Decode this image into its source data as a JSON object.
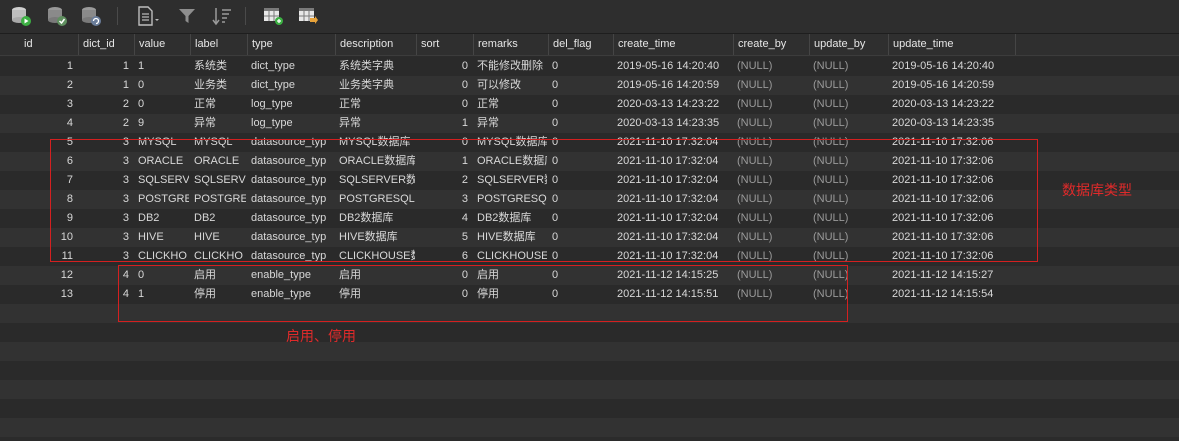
{
  "columns": [
    "id",
    "dict_id",
    "value",
    "label",
    "type",
    "description",
    "sort",
    "remarks",
    "del_flag",
    "create_time",
    "create_by",
    "update_by",
    "update_time"
  ],
  "rows": [
    [
      "1",
      "1",
      "1",
      "系统类",
      "dict_type",
      "系统类字典",
      "0",
      "不能修改删除",
      "0",
      "2019-05-16 14:20:40",
      "(NULL)",
      "(NULL)",
      "2019-05-16 14:20:40"
    ],
    [
      "2",
      "1",
      "0",
      "业务类",
      "dict_type",
      "业务类字典",
      "0",
      "可以修改",
      "0",
      "2019-05-16 14:20:59",
      "(NULL)",
      "(NULL)",
      "2019-05-16 14:20:59"
    ],
    [
      "3",
      "2",
      "0",
      "正常",
      "log_type",
      "正常",
      "0",
      "正常",
      "0",
      "2020-03-13 14:23:22",
      "(NULL)",
      "(NULL)",
      "2020-03-13 14:23:22"
    ],
    [
      "4",
      "2",
      "9",
      "异常",
      "log_type",
      "异常",
      "1",
      "异常",
      "0",
      "2020-03-13 14:23:35",
      "(NULL)",
      "(NULL)",
      "2020-03-13 14:23:35"
    ],
    [
      "5",
      "3",
      "MYSQL",
      "MYSQL",
      "datasource_typ",
      "MYSQL数据库",
      "0",
      "MYSQL数据库",
      "0",
      "2021-11-10 17:32:04",
      "(NULL)",
      "(NULL)",
      "2021-11-10 17:32:06"
    ],
    [
      "6",
      "3",
      "ORACLE",
      "ORACLE",
      "datasource_typ",
      "ORACLE数据库",
      "1",
      "ORACLE数据库",
      "0",
      "2021-11-10 17:32:04",
      "(NULL)",
      "(NULL)",
      "2021-11-10 17:32:06"
    ],
    [
      "7",
      "3",
      "SQLSERV",
      "SQLSERV",
      "datasource_typ",
      "SQLSERVER数据库",
      "2",
      "SQLSERVER数据库",
      "0",
      "2021-11-10 17:32:04",
      "(NULL)",
      "(NULL)",
      "2021-11-10 17:32:06"
    ],
    [
      "8",
      "3",
      "POSTGRE",
      "POSTGRE",
      "datasource_typ",
      "POSTGRESQL",
      "3",
      "POSTGRESQL",
      "0",
      "2021-11-10 17:32:04",
      "(NULL)",
      "(NULL)",
      "2021-11-10 17:32:06"
    ],
    [
      "9",
      "3",
      "DB2",
      "DB2",
      "datasource_typ",
      "DB2数据库",
      "4",
      "DB2数据库",
      "0",
      "2021-11-10 17:32:04",
      "(NULL)",
      "(NULL)",
      "2021-11-10 17:32:06"
    ],
    [
      "10",
      "3",
      "HIVE",
      "HIVE",
      "datasource_typ",
      "HIVE数据库",
      "5",
      "HIVE数据库",
      "0",
      "2021-11-10 17:32:04",
      "(NULL)",
      "(NULL)",
      "2021-11-10 17:32:06"
    ],
    [
      "11",
      "3",
      "CLICKHO",
      "CLICKHO",
      "datasource_typ",
      "CLICKHOUSE数据库",
      "6",
      "CLICKHOUSE数据库",
      "0",
      "2021-11-10 17:32:04",
      "(NULL)",
      "(NULL)",
      "2021-11-10 17:32:06"
    ],
    [
      "12",
      "4",
      "0",
      "启用",
      "enable_type",
      "启用",
      "0",
      "启用",
      "0",
      "2021-11-12 14:15:25",
      "(NULL)",
      "(NULL)",
      "2021-11-12 14:15:27"
    ],
    [
      "13",
      "4",
      "1",
      "停用",
      "enable_type",
      "停用",
      "0",
      "停用",
      "0",
      "2021-11-12 14:15:51",
      "(NULL)",
      "(NULL)",
      "2021-11-12 14:15:54"
    ]
  ],
  "annotations": {
    "db_types": "数据库类型",
    "enable_disable": "启用、停用"
  },
  "toolbar": {
    "icons": [
      "db-start-icon",
      "db-check-icon",
      "db-refresh-icon",
      "document-icon",
      "filter-icon",
      "sort-icon",
      "grid-add-icon",
      "grid-export-icon"
    ]
  },
  "colors": {
    "background": "#2b2b2b",
    "annotation": "#e02a2a",
    "icon_green": "#3cb043",
    "icon_orange": "#e8a33a"
  }
}
